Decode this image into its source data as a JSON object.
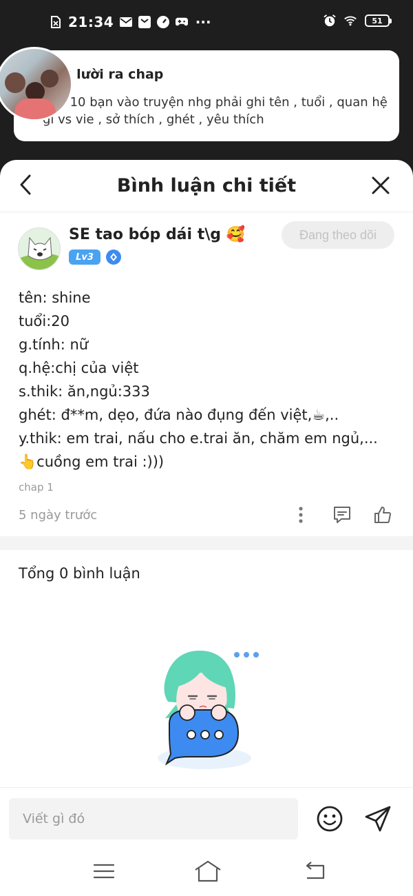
{
  "status_bar": {
    "time": "21:34",
    "battery": "51",
    "icons": [
      "sim-icon",
      "mail-icon",
      "notification-icon",
      "speedometer-icon",
      "gamepad-icon",
      "more-dots-icon",
      "alarm-icon",
      "wifi-icon",
      "battery-icon"
    ],
    "more": "···"
  },
  "post": {
    "title": "/g lười ra chap",
    "text": "hận 10 bạn vào truyện nhg phải ghi tên , tuổi , quan hệ gì vs vie , sở thích , ghét , yêu thích"
  },
  "header": {
    "title": "Bình luận chi tiết"
  },
  "comment": {
    "author_name": "SE tao bóp dái t\\g 🥰",
    "level": "Lv3",
    "follow_label": "Đang theo dõi",
    "lines": [
      "tên: shine",
      "tuổi:20",
      "g.tính: nữ",
      "q.hệ:chị của việt",
      "s.thik: ăn,ngủ:333",
      "ghét: đ**m, dẹo, đứa nào đụng đến việt,☕,..",
      "y.thik: em trai, nấu cho e.trai ăn, chăm em ngủ,...",
      "👆cuồng em trai :)))"
    ],
    "chapter": "chap 1",
    "time_ago": "5 ngày trước"
  },
  "replies": {
    "total_label": "Tổng 0 bình luận"
  },
  "input": {
    "placeholder": "Viết gì đó"
  },
  "colors": {
    "accent_blue": "#4aa3f0",
    "follow_bg": "#eeeeee",
    "follow_text": "#c2c2c2",
    "mascot_hair": "#5fd6b5",
    "bubble_blue": "#3d8bf0"
  }
}
